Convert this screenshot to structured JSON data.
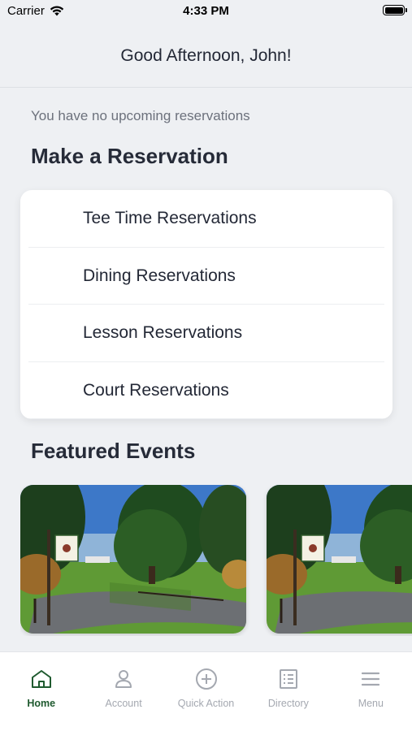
{
  "status_bar": {
    "carrier": "Carrier",
    "time": "4:33 PM"
  },
  "header": {
    "greeting": "Good Afternoon, John!"
  },
  "reservations": {
    "empty_message": "You have no upcoming reservations",
    "title": "Make a Reservation",
    "items": [
      {
        "label": "Tee Time Reservations"
      },
      {
        "label": "Dining Reservations"
      },
      {
        "label": "Lesson Reservations"
      },
      {
        "label": "Court Reservations"
      }
    ]
  },
  "events": {
    "title": "Featured Events",
    "cards": [
      {
        "image": "golf-club-entrance-photo"
      },
      {
        "image": "golf-club-entrance-photo"
      }
    ]
  },
  "tab_bar": {
    "active_color": "#1f5a2f",
    "inactive_color": "#a4a8b0",
    "tabs": [
      {
        "label": "Home",
        "icon": "home-icon",
        "active": true
      },
      {
        "label": "Account",
        "icon": "person-icon",
        "active": false
      },
      {
        "label": "Quick Action",
        "icon": "plus-circle-icon",
        "active": false
      },
      {
        "label": "Directory",
        "icon": "list-icon",
        "active": false
      },
      {
        "label": "Menu",
        "icon": "hamburger-icon",
        "active": false
      }
    ]
  }
}
